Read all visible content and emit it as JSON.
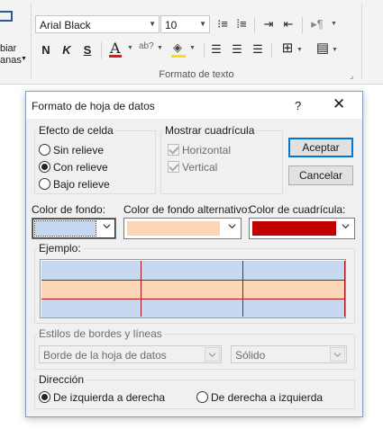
{
  "ribbon": {
    "font_name": "Arial Black",
    "font_size": "10",
    "left_button_lines": [
      "biar",
      "anas"
    ],
    "bold_label": "N",
    "italic_label": "K",
    "underline_label": "S",
    "font_color_label": "A",
    "highlight_label": "ab?",
    "group_label": "Formato de texto",
    "font_color": "#e81123",
    "fill_color": "#ffdd00"
  },
  "dialog": {
    "title": "Formato de hoja de datos",
    "help": "?",
    "close": "✕",
    "cell_effect": {
      "label": "Efecto de celda",
      "options": [
        "Sin relieve",
        "Con relieve",
        "Bajo relieve"
      ],
      "selected": "Con relieve"
    },
    "gridlines": {
      "label": "Mostrar cuadrícula",
      "horizontal": "Horizontal",
      "vertical": "Vertical"
    },
    "ok": "Aceptar",
    "cancel": "Cancelar",
    "background_color": {
      "label": "Color de fondo:",
      "value": "#c6d9f1"
    },
    "alt_background_color": {
      "label": "Color de fondo alternativo:",
      "value": "#fcd5b4"
    },
    "gridline_color": {
      "label": "Color de cuadrícula:",
      "value": "#c00000"
    },
    "sample": {
      "label": "Ejemplo:"
    },
    "border_styles": {
      "label": "Estilos de bordes y líneas",
      "border": "Borde de la hoja de datos",
      "line": "Sólido"
    },
    "direction": {
      "label": "Dirección",
      "ltr": "De izquierda a derecha",
      "rtl": "De derecha a izquierda",
      "selected": "De izquierda a derecha"
    }
  }
}
